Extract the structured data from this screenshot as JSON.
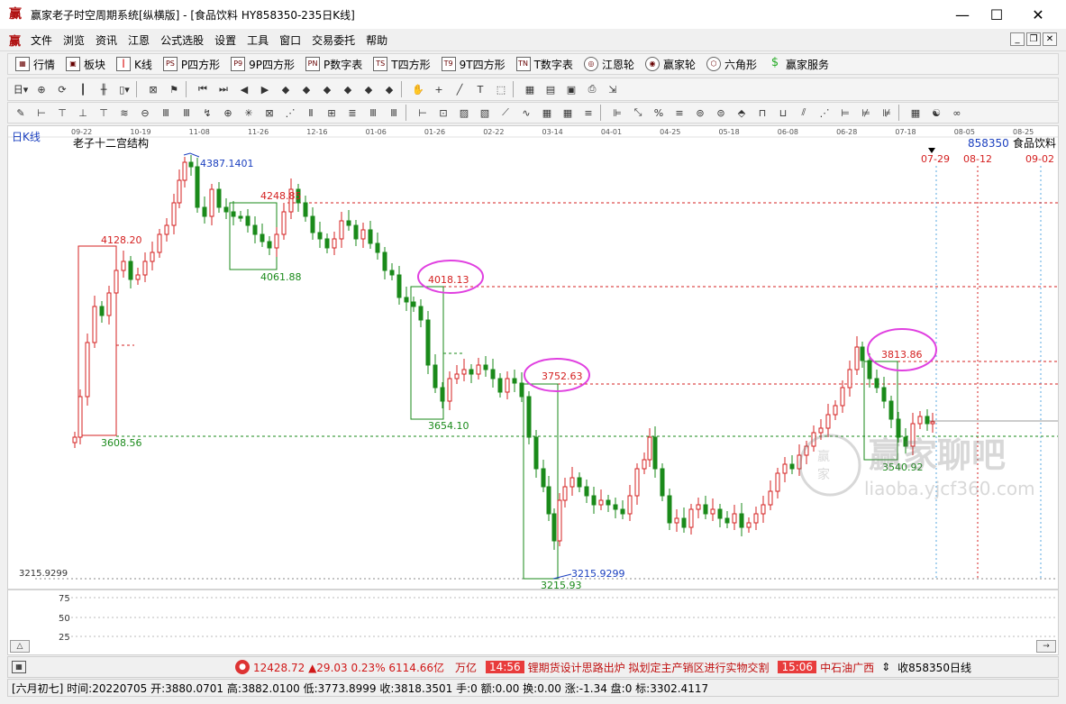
{
  "window": {
    "title": "赢家老子时空周期系统[纵横版] - [食品饮料   HY858350-235日K线]",
    "app_icon": "赢",
    "min": "—",
    "max": "☐",
    "close": "✕"
  },
  "menu": {
    "icon": "赢",
    "items": [
      "文件",
      "浏览",
      "资讯",
      "江恩",
      "公式选股",
      "设置",
      "工具",
      "窗口",
      "交易委托",
      "帮助"
    ],
    "mdi": [
      "_",
      "❐",
      "✕"
    ]
  },
  "toolbar1": [
    {
      "label": "行情",
      "icon": "grid-icon"
    },
    {
      "label": "板块",
      "icon": "blocks-icon"
    },
    {
      "label": "K线",
      "icon": "candles-icon"
    },
    {
      "label": "P四方形",
      "icon": "p-square-icon",
      "code": "PS"
    },
    {
      "label": "9P四方形",
      "icon": "9p-square-icon",
      "code": "P9"
    },
    {
      "label": "P数字表",
      "icon": "p-number-table-icon",
      "code": "PN"
    },
    {
      "label": "T四方形",
      "icon": "t-square-icon",
      "code": "TS"
    },
    {
      "label": "9T四方形",
      "icon": "9t-square-icon",
      "code": "T9"
    },
    {
      "label": "T数字表",
      "icon": "t-number-table-icon",
      "code": "TN"
    },
    {
      "label": "江恩轮",
      "icon": "gann-wheel-icon"
    },
    {
      "label": "赢家轮",
      "icon": "winner-wheel-icon"
    },
    {
      "label": "六角形",
      "icon": "hexagon-icon"
    },
    {
      "label": "赢家服务",
      "icon": "dollar-icon"
    }
  ],
  "chart": {
    "period_label": "日K线",
    "indicator_name": "老子十二宫结构",
    "code": "858350",
    "name": "食品饮料",
    "top_dates": [
      "09-22",
      "10-19",
      "11-08",
      "11-26",
      "12-16",
      "01-06",
      "01-26",
      "02-22",
      "03-14",
      "04-01",
      "04-25",
      "05-18",
      "06-08",
      "06-28",
      "07-18",
      "08-05",
      "08-25"
    ],
    "future_dates": [
      "07-29",
      "08-12",
      "09-02"
    ],
    "price_labels": {
      "high_peak": "4387.1401",
      "p4248": "4248.85",
      "p4128": "4128.20",
      "p4061": "4061.88",
      "p4018": "4018.13",
      "p3813": "3813.86",
      "p3752": "3752.63",
      "p3654": "3654.10",
      "p3608": "3608.56",
      "p3540": "3540.92",
      "low_left": "3215.9299",
      "low_right": "3215.9299",
      "low_bottom": "3215.93"
    },
    "volume_ticks": [
      "75",
      "50",
      "25"
    ],
    "watermark_brand": "赢家聊吧",
    "watermark_url": "liaoba.yjcf360.com",
    "watermark_logo": [
      "赢",
      "家"
    ],
    "colors": {
      "up": "#d42020",
      "down": "#1a8a1a",
      "support": "#1a8a1a",
      "resistance": "#d42020",
      "highlight": "#e040e0"
    },
    "scroll_left": "△",
    "scroll_right": "→"
  },
  "ticker": {
    "box": "▦",
    "idx_icon": "●",
    "index_value": "12428.72 ▲29.03 0.23% 6114.66亿",
    "unit": "万亿",
    "news1_time": "14:56",
    "news1_text": "锂期货设计思路出炉 拟划定主产销区进行实物交割",
    "news2_time": "15:06",
    "news2_text": "中石油广西",
    "updown": "⇕",
    "right_label": "收858350日线"
  },
  "info": {
    "text": "[六月初七] 时间:20220705 开:3880.0701 高:3882.0100 低:3773.8999 收:3818.3501 手:0 额:0.00 换:0.00 涨:-1.34 盘:0 标:3302.4117"
  }
}
